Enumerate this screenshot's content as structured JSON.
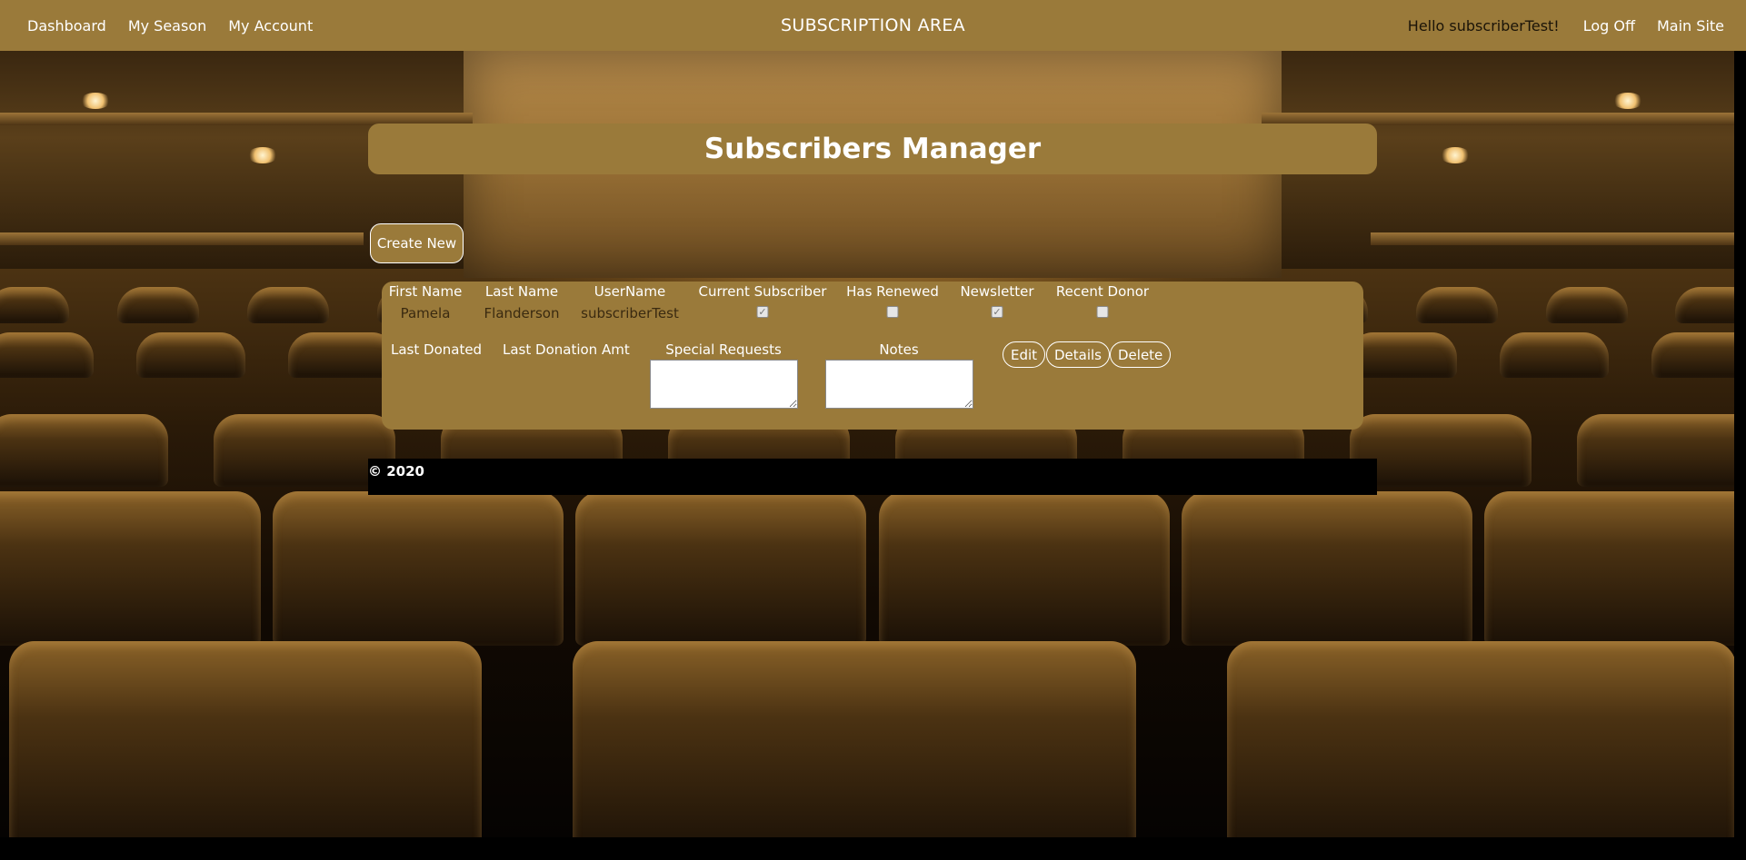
{
  "nav": {
    "left": [
      "Dashboard",
      "My Season",
      "My Account"
    ],
    "title": "SUBSCRIPTION AREA",
    "greeting": "Hello subscriberTest!",
    "logoff": "Log Off",
    "mainsite": "Main Site"
  },
  "page": {
    "heading": "Subscribers Manager",
    "create_new": "Create New"
  },
  "table": {
    "headers": {
      "first_name": "First Name",
      "last_name": "Last Name",
      "username": "UserName",
      "current_subscriber": "Current Subscriber",
      "has_renewed": "Has Renewed",
      "newsletter": "Newsletter",
      "recent_donor": "Recent Donor",
      "last_donated": "Last Donated",
      "last_donation_amt": "Last Donation Amt",
      "special_requests": "Special Requests",
      "notes": "Notes"
    },
    "row": {
      "first_name": "Pamela",
      "last_name": "Flanderson",
      "username": "subscriberTest",
      "current_subscriber": true,
      "has_renewed": false,
      "newsletter": true,
      "recent_donor": false,
      "special_requests": "",
      "notes": ""
    },
    "actions": {
      "edit": "Edit",
      "details": "Details",
      "delete": "Delete"
    }
  },
  "footer": {
    "copyright": "© 2020"
  },
  "colors": {
    "accent": "#9a7a3a",
    "footer_bg": "#000000"
  }
}
